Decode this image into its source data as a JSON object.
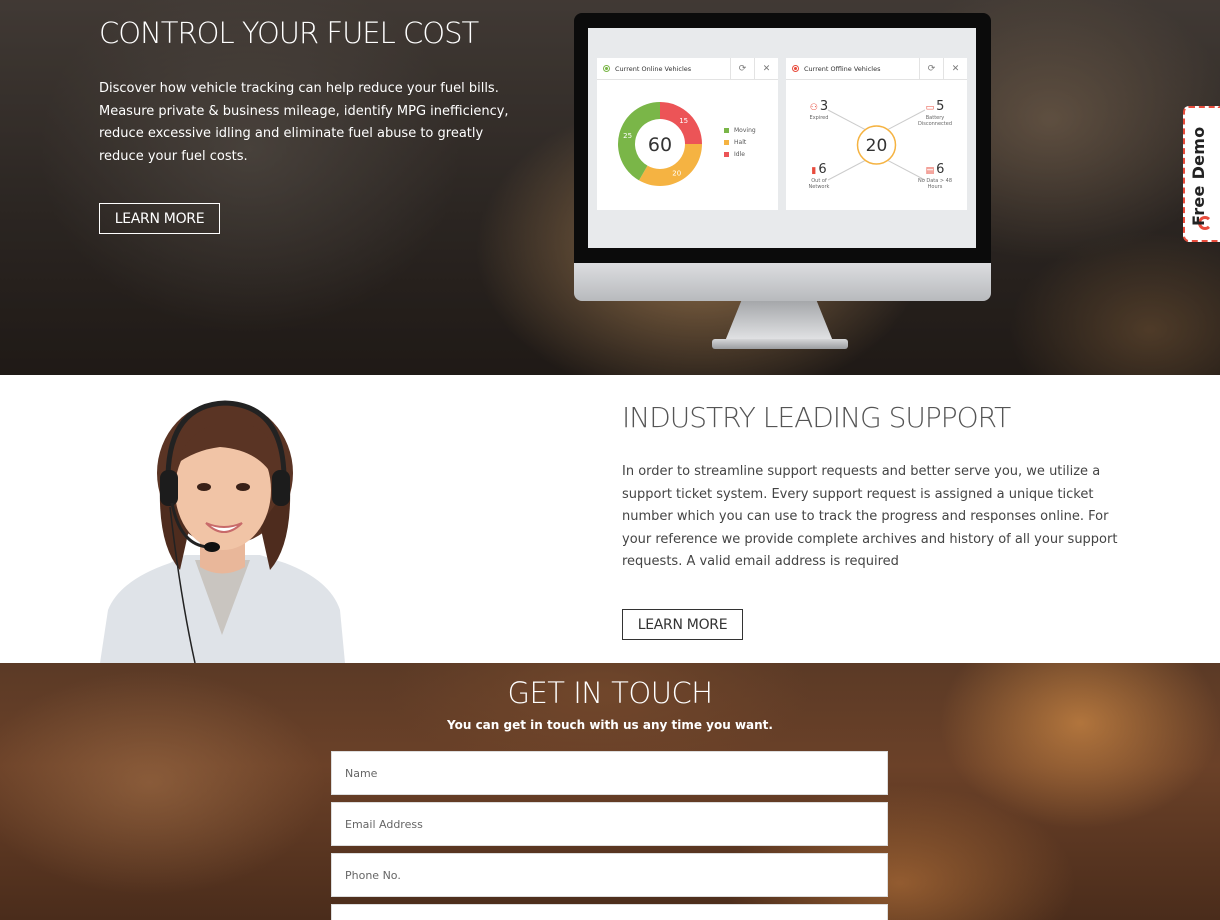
{
  "hero": {
    "title": "CONTROL YOUR FUEL COST",
    "text": "Discover how vehicle tracking can help reduce your fuel bills. Measure private & business mileage, identify MPG inefficiency, reduce excessive idling and eliminate fuel abuse to greatly reduce your fuel costs.",
    "button": "LEARN MORE"
  },
  "dashboard": {
    "online": {
      "title": "Current Online Vehicles",
      "total": "60",
      "segments": [
        {
          "label": "Moving",
          "value": 25,
          "color": "#7ab648"
        },
        {
          "label": "Halt",
          "value": 20,
          "color": "#f5b342"
        },
        {
          "label": "Idle",
          "value": 15,
          "color": "#ec5457"
        }
      ]
    },
    "offline": {
      "title": "Current Offline Vehicles",
      "total": "20",
      "items": [
        {
          "count": "3",
          "label": "Expired"
        },
        {
          "count": "5",
          "label": "Battery Disconnected"
        },
        {
          "count": "6",
          "label": "Out of Network"
        },
        {
          "count": "6",
          "label": "No Data > 48 Hours"
        }
      ]
    }
  },
  "demo_tab": {
    "label": "Free Demo"
  },
  "support": {
    "title": "INDUSTRY LEADING SUPPORT",
    "text": "In order to streamline support requests and better serve you, we utilize a support ticket system. Every support request is assigned a unique ticket number which you can use to track the progress and responses online. For your reference we provide complete archives and history of all your support requests. A valid email address is required",
    "button": "LEARN MORE"
  },
  "contact": {
    "title": "GET IN TOUCH",
    "subtitle": "You can get in touch with us any time you want.",
    "fields": {
      "name": "Name",
      "email": "Email Address",
      "phone": "Phone No.",
      "message": ""
    }
  },
  "colors": {
    "accent_red": "#e74c3c",
    "moving": "#7ab648",
    "halt": "#f5b342",
    "idle": "#ec5457"
  }
}
